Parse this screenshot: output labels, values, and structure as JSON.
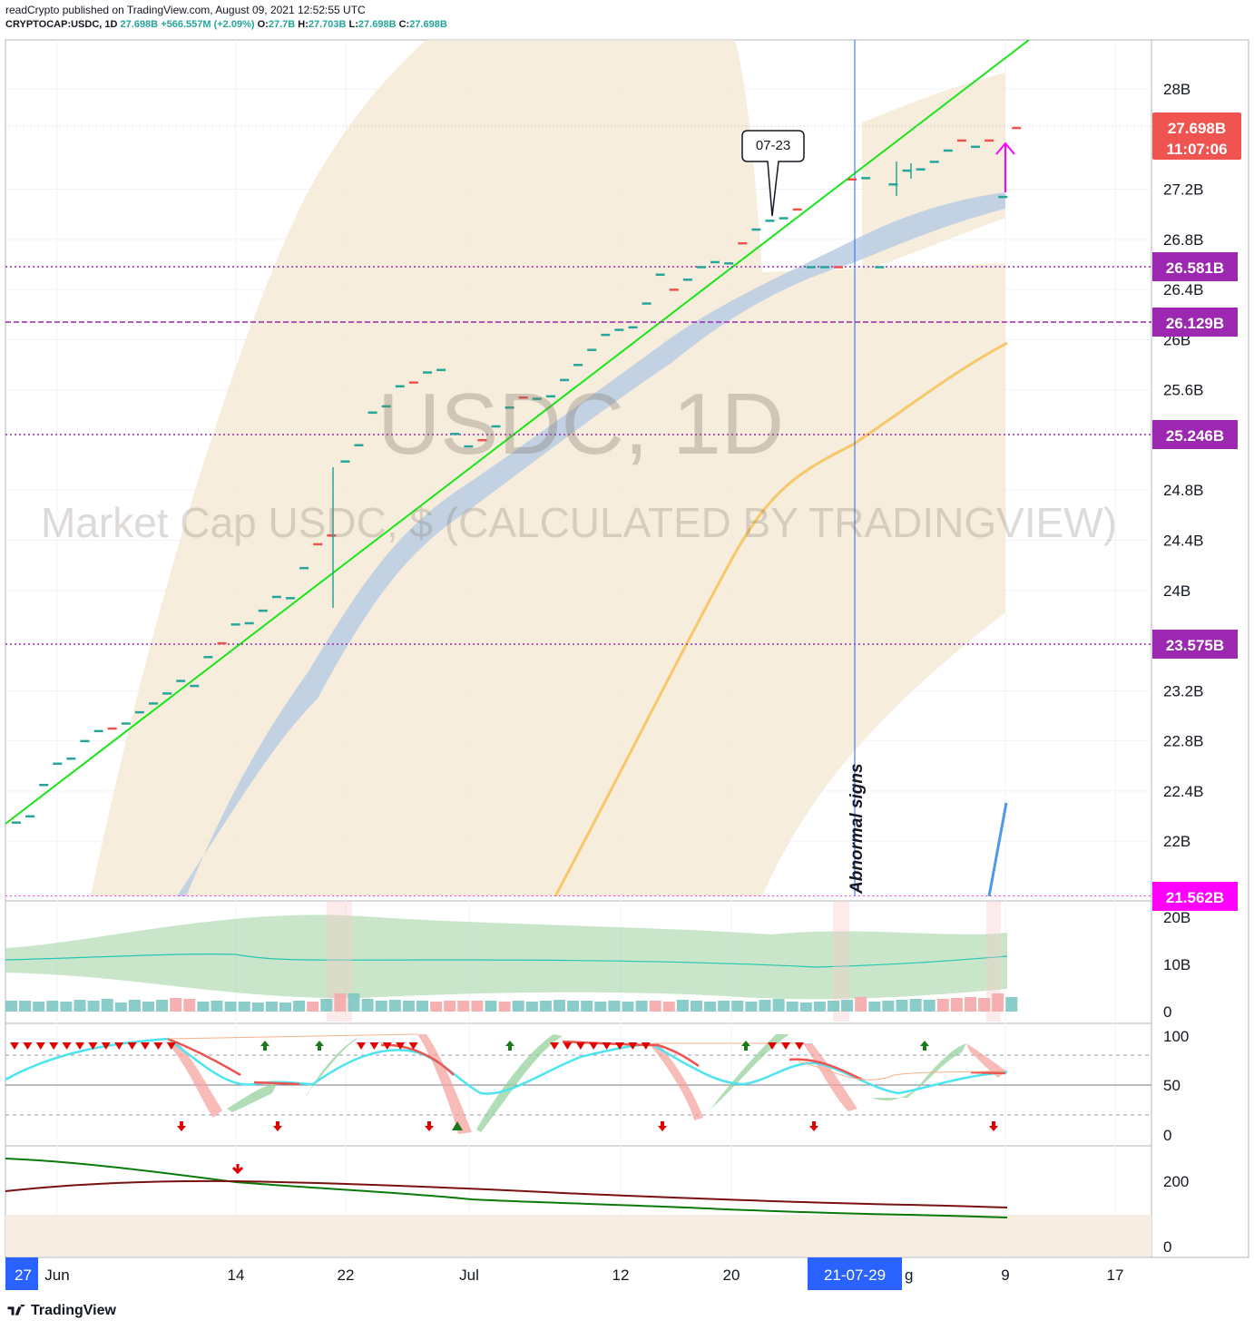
{
  "header": {
    "author_line": "readCrypto published on TradingView.com, August 09, 2021 12:52:55 UTC",
    "symbol": "CRYPTOCAP:USDC, 1D",
    "last": "27.698B",
    "change": "+566.557M (+2.09%)",
    "o_label": "O:",
    "o": "27.7B",
    "h_label": "H:",
    "h": "27.703B",
    "l_label": "L:",
    "l": "27.698B",
    "c_label": "C:",
    "c": "27.698B"
  },
  "watermark": {
    "title": "USDC, 1D",
    "subtitle": "Market Cap USDC, $ (CALCULATED BY TRADINGVIEW)"
  },
  "footer": {
    "brand": "TradingView"
  },
  "colors": {
    "up": "#26a69a",
    "down": "#ef5350",
    "trend": "#19e619",
    "band": "#f5ead7",
    "ribbon": "#b8cde3",
    "ma": "#f6c86a",
    "level": "#9c27b0",
    "magenta": "#ff00ff",
    "price_tag": "#f05450",
    "level_tag": "#9c27b0",
    "time_tag": "#2962ff"
  },
  "chart_data": [
    {
      "type": "line",
      "name": "main",
      "y_ticks": [
        "28B",
        "27.2B",
        "26.8B",
        "26.4B",
        "26B",
        "25.6B",
        "24.8B",
        "24.4B",
        "24B",
        "23.2B",
        "22.8B",
        "22.4B",
        "22B"
      ],
      "x_ticks": [
        "Jun",
        "14",
        "22",
        "Jul",
        "12",
        "20",
        "9",
        "17"
      ],
      "time_tag": "21-07-29",
      "time_tag_edge_left": "27",
      "time_tag_edge_right": "g",
      "price_tag": {
        "value": "27.698B",
        "countdown": "11:07:06"
      },
      "levels": [
        "26.581B",
        "26.129B",
        "25.246B",
        "23.575B",
        "21.562B"
      ],
      "annotations": {
        "callout": "07-23",
        "vertical_text": "Abnormal signs"
      },
      "candles": [
        [
          0,
          22.15
        ],
        [
          1,
          22.2
        ],
        [
          2,
          22.45
        ],
        [
          3,
          22.62
        ],
        [
          4,
          22.66
        ],
        [
          5,
          22.8
        ],
        [
          6,
          22.88
        ],
        [
          7,
          22.9
        ],
        [
          8,
          22.94
        ],
        [
          9,
          23.03
        ],
        [
          10,
          23.1
        ],
        [
          11,
          23.18
        ],
        [
          12,
          23.28
        ],
        [
          13,
          23.24
        ],
        [
          14,
          23.47
        ],
        [
          15,
          23.58
        ],
        [
          16,
          23.73
        ],
        [
          17,
          23.74
        ],
        [
          18,
          23.84
        ],
        [
          19,
          23.95
        ],
        [
          20,
          23.94
        ],
        [
          21,
          24.18
        ],
        [
          22,
          24.37
        ],
        [
          23,
          24.44
        ],
        [
          24,
          25.03
        ],
        [
          25,
          25.16
        ],
        [
          26,
          25.42
        ],
        [
          27,
          25.47
        ],
        [
          28,
          25.63
        ],
        [
          29,
          25.66
        ],
        [
          30,
          25.74
        ],
        [
          31,
          25.76
        ],
        [
          32,
          25.25
        ],
        [
          33,
          25.15
        ],
        [
          34,
          25.2
        ],
        [
          35,
          25.31
        ],
        [
          36,
          25.46
        ],
        [
          37,
          25.54
        ],
        [
          38,
          25.53
        ],
        [
          39,
          25.55
        ],
        [
          40,
          25.68
        ],
        [
          41,
          25.8
        ],
        [
          42,
          25.92
        ],
        [
          43,
          26.04
        ],
        [
          44,
          26.08
        ],
        [
          45,
          26.1
        ],
        [
          46,
          26.29
        ],
        [
          47,
          26.52
        ],
        [
          48,
          26.4
        ],
        [
          49,
          26.48
        ],
        [
          50,
          26.58
        ],
        [
          51,
          26.62
        ],
        [
          52,
          26.61
        ],
        [
          53,
          26.77
        ],
        [
          54,
          26.88
        ],
        [
          55,
          26.95
        ],
        [
          56,
          26.97
        ],
        [
          57,
          27.04
        ],
        [
          58,
          26.58
        ],
        [
          59,
          26.58
        ],
        [
          60,
          26.58
        ],
        [
          61,
          27.28
        ],
        [
          62,
          27.29
        ],
        [
          63,
          26.58
        ],
        [
          64,
          27.24
        ],
        [
          65,
          27.35
        ],
        [
          66,
          27.36
        ],
        [
          67,
          27.42
        ],
        [
          68,
          27.51
        ],
        [
          69,
          27.59
        ],
        [
          70,
          27.54
        ],
        [
          71,
          27.59
        ],
        [
          72,
          27.14
        ],
        [
          73,
          27.69
        ]
      ]
    },
    {
      "type": "bar",
      "name": "volume",
      "y_ticks": [
        "20B",
        "10B",
        "0"
      ]
    },
    {
      "type": "line",
      "name": "oscillator",
      "y_ticks": [
        "100",
        "50",
        "0"
      ]
    },
    {
      "type": "line",
      "name": "lower",
      "y_ticks": [
        "200",
        "0"
      ]
    }
  ]
}
